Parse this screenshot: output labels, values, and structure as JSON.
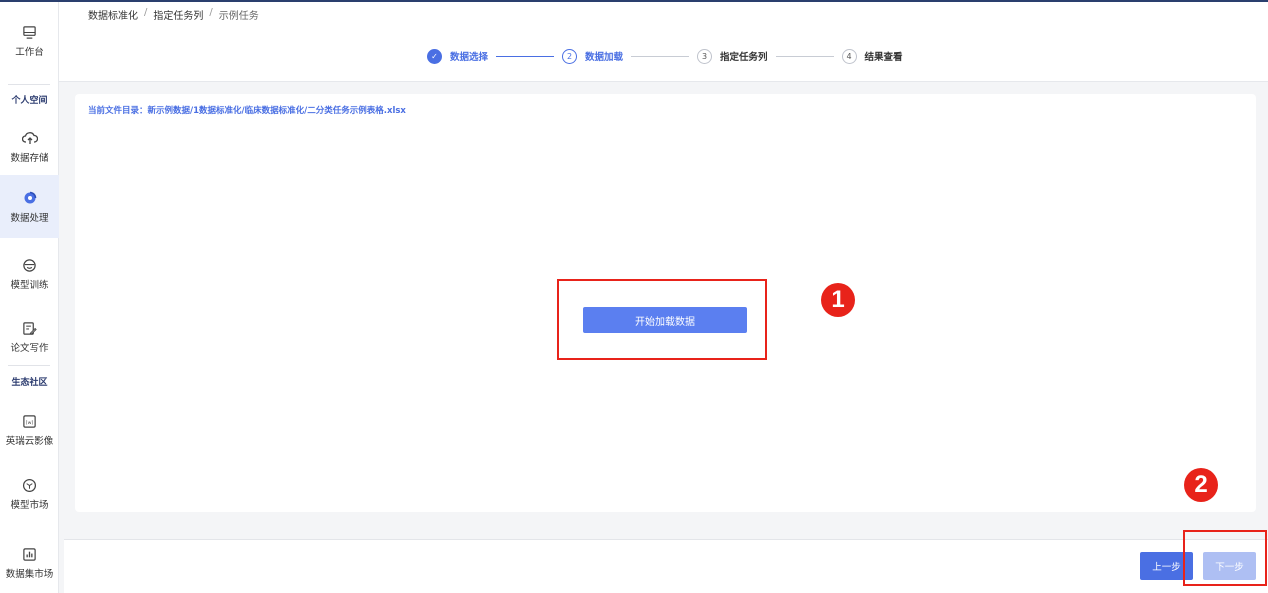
{
  "breadcrumb": {
    "items": [
      "数据标准化",
      "指定任务列",
      "示例任务"
    ],
    "separator": "/"
  },
  "sidebar": {
    "items": [
      {
        "label": "工作台",
        "icon": "monitor-icon"
      },
      {
        "label": "数据存储",
        "icon": "cloud-upload-icon"
      },
      {
        "label": "数据处理",
        "icon": "data-process-icon",
        "active": true
      },
      {
        "label": "模型训练",
        "icon": "model-train-icon"
      },
      {
        "label": "论文写作",
        "icon": "paper-edit-icon"
      },
      {
        "label": "英瑞云影像",
        "icon": "image-frame-icon"
      },
      {
        "label": "模型市场",
        "icon": "cube-icon"
      },
      {
        "label": "数据集市场",
        "icon": "bar-chart-icon"
      }
    ],
    "sections": {
      "personal": "个人空间",
      "community": "生态社区"
    }
  },
  "steps": [
    {
      "number": "✓",
      "label": "数据选择",
      "state": "done"
    },
    {
      "number": "2",
      "label": "数据加载",
      "state": "active"
    },
    {
      "number": "3",
      "label": "指定任务列",
      "state": "todo"
    },
    {
      "number": "4",
      "label": "结果查看",
      "state": "todo"
    }
  ],
  "content": {
    "file_path": "当前文件目录：新示例数据/1数据标准化/临床数据标准化/二分类任务示例表格.xlsx",
    "start_button": "开始加载数据"
  },
  "footer": {
    "prev_label": "上一步",
    "next_label": "下一步"
  },
  "annotations": {
    "marker_1": "1",
    "marker_2": "2"
  },
  "colors": {
    "primary": "#4a6fe3",
    "primary_disabled": "#aebff3",
    "annotation_red": "#e8231a",
    "sidebar_active_bg": "#e9eefb"
  }
}
